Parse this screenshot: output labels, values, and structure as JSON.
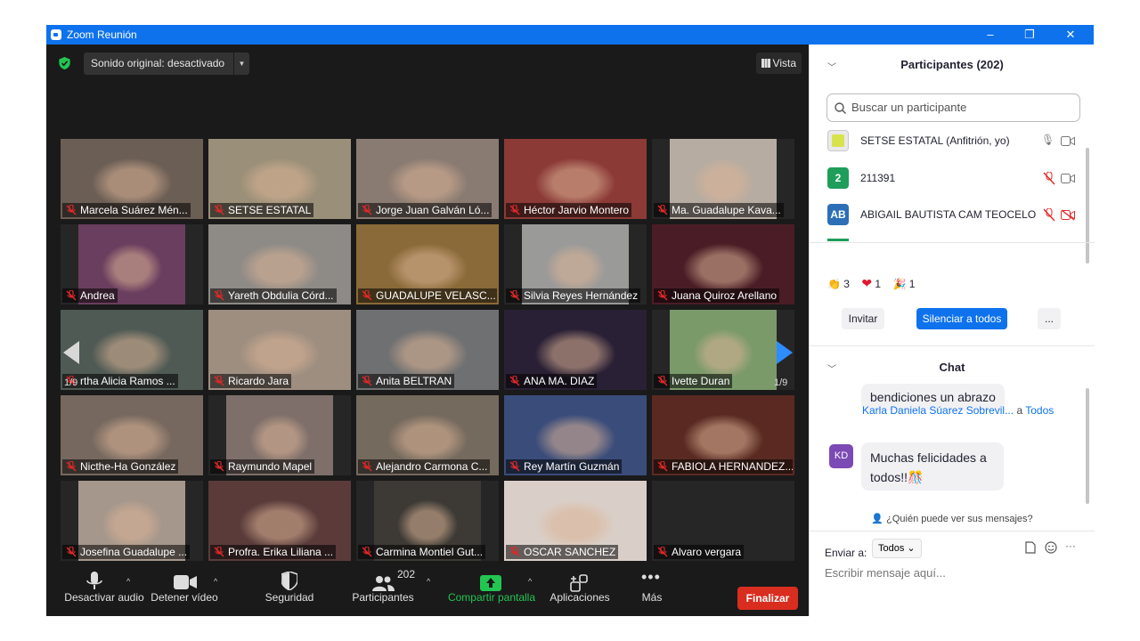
{
  "window": {
    "title": "Zoom Reunión",
    "controls": [
      "–",
      "❐",
      "✕"
    ]
  },
  "topbar": {
    "sound": "Sonido original: desactivado",
    "view": "Vista"
  },
  "grid": {
    "page": "1/9",
    "tiles": [
      {
        "name": "Marcela Suárez Mén...",
        "bg": "#6b5e55"
      },
      {
        "name": "SETSE ESTATAL",
        "bg": "#9a8f78",
        "active": true
      },
      {
        "name": "Jorge Juan Galván Ló...",
        "bg": "#8a7b72"
      },
      {
        "name": "Héctor Jarvio Montero",
        "bg": "#8b3a36"
      },
      {
        "name": "Ma. Guadalupe Kava...",
        "bg": "#b7aca1"
      },
      {
        "name": "Andrea",
        "bg": "#6a3e5e"
      },
      {
        "name": "Yareth Obdulia Córd...",
        "bg": "#8e8a86"
      },
      {
        "name": "GUADALUPE VELASC...",
        "bg": "#8a6a38"
      },
      {
        "name": "Silvia Reyes Hernández",
        "bg": "#9a9a99"
      },
      {
        "name": "Juana Quiroz Arellano",
        "bg": "#4a1d26"
      },
      {
        "name": "rtha Alicia Ramos ...",
        "bg": "#4f5a54"
      },
      {
        "name": "Ricardo Jara",
        "bg": "#9e8e80"
      },
      {
        "name": "Anita BELTRAN",
        "bg": "#6f7071"
      },
      {
        "name": "ANA MA. DIAZ",
        "bg": "#2a2035"
      },
      {
        "name": "Ivette Duran",
        "bg": "#7a9a6a"
      },
      {
        "name": "Nicthe-Ha González",
        "bg": "#76685f"
      },
      {
        "name": "Raymundo Mapel",
        "bg": "#7e6f6a"
      },
      {
        "name": "Alejandro Carmona C...",
        "bg": "#756a5e"
      },
      {
        "name": "Rey Martín Guzmán",
        "bg": "#3a4c7a"
      },
      {
        "name": "FABIOLA HERNANDEZ...",
        "bg": "#5a2a22"
      },
      {
        "name": "Josefina Guadalupe ...",
        "bg": "#a6978c"
      },
      {
        "name": "Profra. Erika Liliana ...",
        "bg": "#5a3b3a"
      },
      {
        "name": "Carmina  Montiel Gut...",
        "bg": "#3d3a35"
      },
      {
        "name": "OSCAR SANCHEZ",
        "bg": "#d9cfc8"
      },
      {
        "name": "Alvaro vergara",
        "bg": ""
      }
    ]
  },
  "toolbar": {
    "mute": "Desactivar audio",
    "video": "Detener vídeo",
    "security": "Seguridad",
    "participants": "Participantes",
    "participants_count": "202",
    "share": "Compartir pantalla",
    "apps": "Aplicaciones",
    "more": "Más",
    "end": "Finalizar"
  },
  "participants_panel": {
    "title": "Participantes (202)",
    "search_placeholder": "Buscar un participante",
    "rows": [
      {
        "initials": "",
        "name": "SETSE ESTATAL (Anfitrión, yo)",
        "color": "#e9e9e9"
      },
      {
        "initials": "2",
        "name": "211391",
        "color": "#1e9e5a"
      },
      {
        "initials": "AB",
        "name": "ABIGAIL BAUTISTA CAM TEOCELO",
        "color": "#2c6fb6"
      }
    ],
    "reactions": [
      {
        "emoji": "👏",
        "count": "3"
      },
      {
        "emoji": "❤",
        "count": "1"
      },
      {
        "emoji": "🎉",
        "count": "1"
      }
    ],
    "invite": "Invitar",
    "mute_all": "Silenciar a todos",
    "more": "..."
  },
  "chat": {
    "title": "Chat",
    "prev_message": "bendiciones un abrazo",
    "sender_name": "Karla Daniela  Súarez Sobrevil...",
    "sender_to": "a",
    "recipient": "Todos",
    "sender_initials": "KD",
    "message": "Muchas felicidades a todos!!🎊",
    "who_can_see": "¿Quién puede ver sus mensajes?",
    "send_to_label": "Enviar a:",
    "send_to_value": "Todos",
    "compose_placeholder": "Escribir mensaje aquí..."
  }
}
